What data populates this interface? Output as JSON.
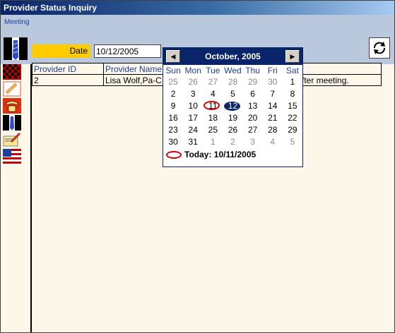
{
  "window": {
    "title": "Provider Status Inquiry"
  },
  "menu": {
    "meeting": "Meeting"
  },
  "filter": {
    "date_label": "Date",
    "date_value": "10/12/2005"
  },
  "grid": {
    "columns": [
      "Provider ID",
      "Provider Name"
    ],
    "rows": [
      {
        "provider_id": "2",
        "provider_name": "Lisa Wolf,Pa-C",
        "note": "fter meeting."
      }
    ]
  },
  "calendar": {
    "month_label": "October, 2005",
    "weekdays": [
      "Sun",
      "Mon",
      "Tue",
      "Wed",
      "Thu",
      "Fri",
      "Sat"
    ],
    "weeks": [
      [
        "25",
        "26",
        "27",
        "28",
        "29",
        "30",
        "1"
      ],
      [
        "2",
        "3",
        "4",
        "5",
        "6",
        "7",
        "8"
      ],
      [
        "9",
        "10",
        "11",
        "12",
        "13",
        "14",
        "15"
      ],
      [
        "16",
        "17",
        "18",
        "19",
        "20",
        "21",
        "22"
      ],
      [
        "23",
        "24",
        "25",
        "26",
        "27",
        "28",
        "29"
      ],
      [
        "30",
        "31",
        "1",
        "2",
        "3",
        "4",
        "5"
      ]
    ],
    "today_label": "Today: 10/11/2005",
    "selected_day": "12",
    "today_day": "11"
  },
  "colors": {
    "title_bar": "#0a246a",
    "date_label_bg": "#ffcc00",
    "body_bg": "#fdf7ea",
    "band_bg": "#b9c8dc"
  }
}
